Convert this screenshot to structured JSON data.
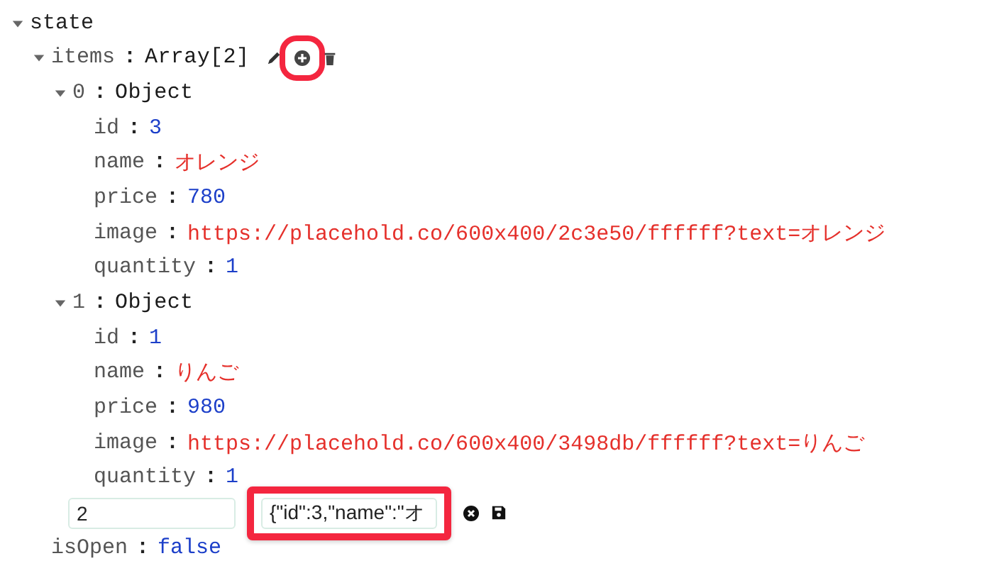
{
  "separator": ":",
  "tree": [
    {
      "key": "state",
      "kind": "root",
      "expanded": true,
      "children": [
        {
          "key": "items",
          "value": "Array[2]",
          "kind": "type",
          "expanded": true,
          "actions": [
            {
              "kind": "edit",
              "highlighted": false
            },
            {
              "kind": "add",
              "highlighted": true
            },
            {
              "kind": "delete",
              "highlighted": false
            }
          ],
          "children": [
            {
              "key": "0",
              "value": "Object",
              "kind": "type",
              "expanded": true,
              "children": [
                {
                  "key": "id",
                  "value": "3",
                  "kind": "number"
                },
                {
                  "key": "name",
                  "value": "オレンジ",
                  "kind": "string"
                },
                {
                  "key": "price",
                  "value": "780",
                  "kind": "number"
                },
                {
                  "key": "image",
                  "value": "https://placehold.co/600x400/2c3e50/ffffff?text=オレンジ",
                  "kind": "string"
                },
                {
                  "key": "quantity",
                  "value": "1",
                  "kind": "number"
                }
              ]
            },
            {
              "key": "1",
              "value": "Object",
              "kind": "type",
              "expanded": true,
              "children": [
                {
                  "key": "id",
                  "value": "1",
                  "kind": "number"
                },
                {
                  "key": "name",
                  "value": "りんご",
                  "kind": "string"
                },
                {
                  "key": "price",
                  "value": "980",
                  "kind": "number"
                },
                {
                  "key": "image",
                  "value": "https://placehold.co/600x400/3498db/ffffff?text=りんご",
                  "kind": "string"
                },
                {
                  "key": "quantity",
                  "value": "1",
                  "kind": "number"
                }
              ]
            }
          ],
          "new_entry": {
            "key": "2",
            "value": "{\"id\":3,\"name\":\"オ",
            "highlighted": true
          }
        },
        {
          "key": "isOpen",
          "value": "false",
          "kind": "boolean"
        }
      ]
    }
  ]
}
